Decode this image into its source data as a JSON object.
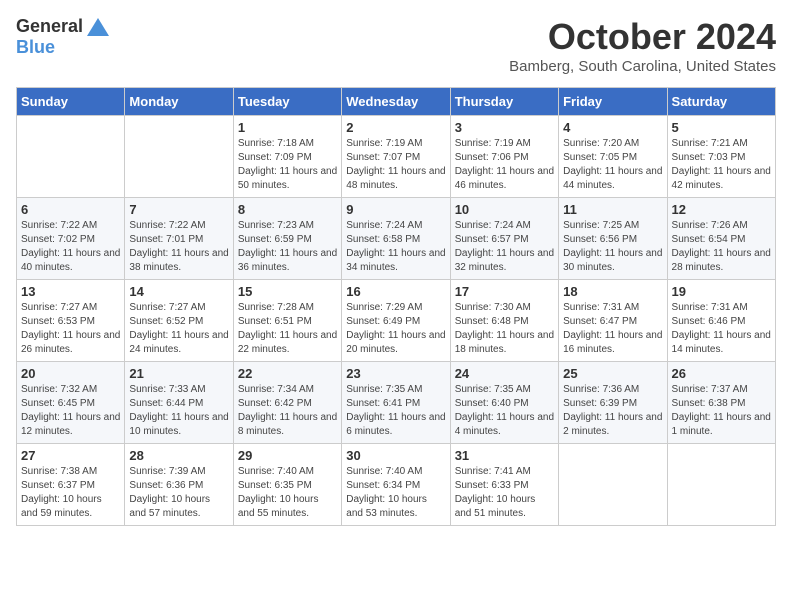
{
  "logo": {
    "general": "General",
    "blue": "Blue"
  },
  "title": "October 2024",
  "location": "Bamberg, South Carolina, United States",
  "weekdays": [
    "Sunday",
    "Monday",
    "Tuesday",
    "Wednesday",
    "Thursday",
    "Friday",
    "Saturday"
  ],
  "weeks": [
    [
      {
        "day": "",
        "info": ""
      },
      {
        "day": "",
        "info": ""
      },
      {
        "day": "1",
        "info": "Sunrise: 7:18 AM\nSunset: 7:09 PM\nDaylight: 11 hours and 50 minutes."
      },
      {
        "day": "2",
        "info": "Sunrise: 7:19 AM\nSunset: 7:07 PM\nDaylight: 11 hours and 48 minutes."
      },
      {
        "day": "3",
        "info": "Sunrise: 7:19 AM\nSunset: 7:06 PM\nDaylight: 11 hours and 46 minutes."
      },
      {
        "day": "4",
        "info": "Sunrise: 7:20 AM\nSunset: 7:05 PM\nDaylight: 11 hours and 44 minutes."
      },
      {
        "day": "5",
        "info": "Sunrise: 7:21 AM\nSunset: 7:03 PM\nDaylight: 11 hours and 42 minutes."
      }
    ],
    [
      {
        "day": "6",
        "info": "Sunrise: 7:22 AM\nSunset: 7:02 PM\nDaylight: 11 hours and 40 minutes."
      },
      {
        "day": "7",
        "info": "Sunrise: 7:22 AM\nSunset: 7:01 PM\nDaylight: 11 hours and 38 minutes."
      },
      {
        "day": "8",
        "info": "Sunrise: 7:23 AM\nSunset: 6:59 PM\nDaylight: 11 hours and 36 minutes."
      },
      {
        "day": "9",
        "info": "Sunrise: 7:24 AM\nSunset: 6:58 PM\nDaylight: 11 hours and 34 minutes."
      },
      {
        "day": "10",
        "info": "Sunrise: 7:24 AM\nSunset: 6:57 PM\nDaylight: 11 hours and 32 minutes."
      },
      {
        "day": "11",
        "info": "Sunrise: 7:25 AM\nSunset: 6:56 PM\nDaylight: 11 hours and 30 minutes."
      },
      {
        "day": "12",
        "info": "Sunrise: 7:26 AM\nSunset: 6:54 PM\nDaylight: 11 hours and 28 minutes."
      }
    ],
    [
      {
        "day": "13",
        "info": "Sunrise: 7:27 AM\nSunset: 6:53 PM\nDaylight: 11 hours and 26 minutes."
      },
      {
        "day": "14",
        "info": "Sunrise: 7:27 AM\nSunset: 6:52 PM\nDaylight: 11 hours and 24 minutes."
      },
      {
        "day": "15",
        "info": "Sunrise: 7:28 AM\nSunset: 6:51 PM\nDaylight: 11 hours and 22 minutes."
      },
      {
        "day": "16",
        "info": "Sunrise: 7:29 AM\nSunset: 6:49 PM\nDaylight: 11 hours and 20 minutes."
      },
      {
        "day": "17",
        "info": "Sunrise: 7:30 AM\nSunset: 6:48 PM\nDaylight: 11 hours and 18 minutes."
      },
      {
        "day": "18",
        "info": "Sunrise: 7:31 AM\nSunset: 6:47 PM\nDaylight: 11 hours and 16 minutes."
      },
      {
        "day": "19",
        "info": "Sunrise: 7:31 AM\nSunset: 6:46 PM\nDaylight: 11 hours and 14 minutes."
      }
    ],
    [
      {
        "day": "20",
        "info": "Sunrise: 7:32 AM\nSunset: 6:45 PM\nDaylight: 11 hours and 12 minutes."
      },
      {
        "day": "21",
        "info": "Sunrise: 7:33 AM\nSunset: 6:44 PM\nDaylight: 11 hours and 10 minutes."
      },
      {
        "day": "22",
        "info": "Sunrise: 7:34 AM\nSunset: 6:42 PM\nDaylight: 11 hours and 8 minutes."
      },
      {
        "day": "23",
        "info": "Sunrise: 7:35 AM\nSunset: 6:41 PM\nDaylight: 11 hours and 6 minutes."
      },
      {
        "day": "24",
        "info": "Sunrise: 7:35 AM\nSunset: 6:40 PM\nDaylight: 11 hours and 4 minutes."
      },
      {
        "day": "25",
        "info": "Sunrise: 7:36 AM\nSunset: 6:39 PM\nDaylight: 11 hours and 2 minutes."
      },
      {
        "day": "26",
        "info": "Sunrise: 7:37 AM\nSunset: 6:38 PM\nDaylight: 11 hours and 1 minute."
      }
    ],
    [
      {
        "day": "27",
        "info": "Sunrise: 7:38 AM\nSunset: 6:37 PM\nDaylight: 10 hours and 59 minutes."
      },
      {
        "day": "28",
        "info": "Sunrise: 7:39 AM\nSunset: 6:36 PM\nDaylight: 10 hours and 57 minutes."
      },
      {
        "day": "29",
        "info": "Sunrise: 7:40 AM\nSunset: 6:35 PM\nDaylight: 10 hours and 55 minutes."
      },
      {
        "day": "30",
        "info": "Sunrise: 7:40 AM\nSunset: 6:34 PM\nDaylight: 10 hours and 53 minutes."
      },
      {
        "day": "31",
        "info": "Sunrise: 7:41 AM\nSunset: 6:33 PM\nDaylight: 10 hours and 51 minutes."
      },
      {
        "day": "",
        "info": ""
      },
      {
        "day": "",
        "info": ""
      }
    ]
  ]
}
